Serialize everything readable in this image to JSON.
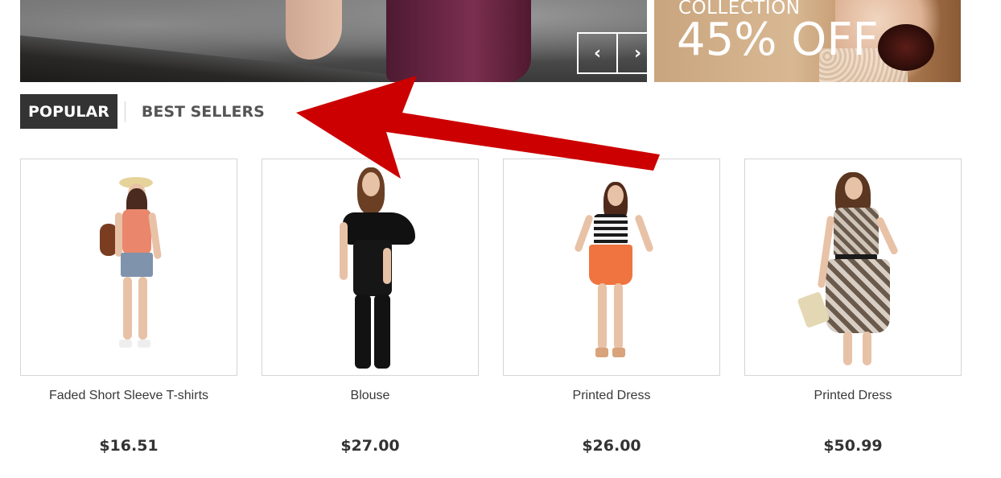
{
  "slider": {
    "prev_icon": "chevron-left-icon",
    "next_icon": "chevron-right-icon",
    "prev_glyph": "‹",
    "next_glyph": "›"
  },
  "promo": {
    "kicker": "COLLECTION",
    "headline": "45% OFF"
  },
  "tabs": [
    {
      "label": "POPULAR",
      "active": true
    },
    {
      "label": "BEST SELLERS",
      "active": false
    }
  ],
  "products": [
    {
      "name": "Faded Short Sleeve T-shirts",
      "price": "$16.51"
    },
    {
      "name": "Blouse",
      "price": "$27.00"
    },
    {
      "name": "Printed Dress",
      "price": "$26.00"
    },
    {
      "name": "Printed Dress",
      "price": "$50.99"
    }
  ],
  "colors": {
    "tab_active_bg": "#333333",
    "annotation_arrow": "#cc0000",
    "border": "#d6d4d4"
  }
}
